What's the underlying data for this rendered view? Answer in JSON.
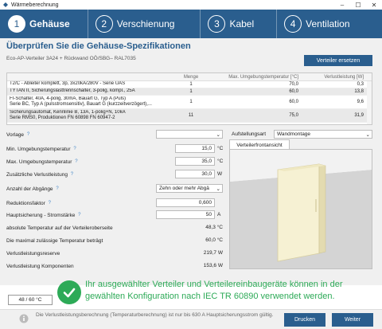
{
  "window": {
    "title": "Wärmeberechnung"
  },
  "steps": [
    {
      "num": "1",
      "label": "Gehäuse"
    },
    {
      "num": "2",
      "label": "Verschienung"
    },
    {
      "num": "3",
      "label": "Kabel"
    },
    {
      "num": "4",
      "label": "Ventilation"
    }
  ],
  "main": {
    "heading": "Überprüfen Sie die Gehäuse-Spezifikationen",
    "subheading": "Eco-AP-Verteiler 3A24 + Rückwand OÖ/SBG– RAL7035",
    "replace_button": "Verteiler ersetzen"
  },
  "table": {
    "headers": [
      "",
      "Menge",
      "Max. Umgebungstemperatur [°C]",
      "Verlustleistung [W]"
    ],
    "rows": [
      {
        "name": "T2/C - Ableiter komplett, 3p, 3x20kA/280V - Serie UAS",
        "qty": "1",
        "temp": "70,0",
        "loss": "0,3"
      },
      {
        "name": "TYTAN II, Sicherungslasttrennschalter, 3-polig, kompl., 25A",
        "qty": "1",
        "temp": "60,0",
        "loss": "13,8"
      },
      {
        "name": "FI-Schalter, 40A, 4-polig, 30mA, Bauart G, Typ A (Puls)\nSerie BC, Typ A (pulsstromsensitiv), Bauart G (kurzzeitverzögert),...",
        "qty": "1",
        "temp": "60,0",
        "loss": "9,6"
      },
      {
        "name": "Sicherungsautomat, Kennlinie B, 13A, 1-polig+N, 10kA\nSerie RMS0, Produktionen FN 60898 FN 60947-2",
        "qty": "11",
        "temp": "75,0",
        "loss": "31,9"
      }
    ]
  },
  "form": {
    "vorlage_label": "Vorlage",
    "vorlage_value": "",
    "min_temp_label": "Min. Umgebungstemperatur",
    "min_temp_value": "15,0",
    "min_temp_unit": "°C",
    "max_temp_label": "Max. Umgebungstemperatur",
    "max_temp_value": "35,0",
    "max_temp_unit": "°C",
    "extra_loss_label": "Zusätzliche Verlustleistung",
    "extra_loss_value": "30,0",
    "extra_loss_unit": "W",
    "outlets_label": "Anzahl der Abgänge",
    "outlets_value": "Zehn oder mehr Abgä",
    "reduction_label": "Reduktionsfaktor",
    "reduction_value": "0,600",
    "main_fuse_label": "Hauptsicherung - Stromstärke",
    "main_fuse_value": "50",
    "main_fuse_unit": "A",
    "abs_temp_label": "absolute Temperatur auf der Verteileroberseite",
    "abs_temp_value": "48,3 °C",
    "max_allowed_label": "Die maximal zulässige Temperatur beträgt",
    "max_allowed_value": "60,0 °C",
    "reserve_label": "Verlustleistungsreserve",
    "reserve_value": "219,7 W",
    "components_label": "Verlustleistung Komponenten",
    "components_value": "153,6 W",
    "installation_label": "Aufstellungsart",
    "installation_value": "Wandmontage",
    "front_tab": "Verteilerfrontansicht"
  },
  "footer": {
    "temp_box": "48 / 60 °C",
    "message": "Ihr ausgewählter Verteiler und Verteilereinbaugeräte können in der gewählten Konfiguration nach IEC TR 60890 verwendet werden.",
    "info": "Die Verlustleistungsberechnung (Temperaturberechnung) ist nur bis 630 A Hauptsicherungsstrom gültig.",
    "back_button": "Drucken",
    "next_button": "Weiter"
  },
  "colors": {
    "primary": "#2a5e8e",
    "success": "#2daa57",
    "cabinet": "#f5f0d0"
  }
}
